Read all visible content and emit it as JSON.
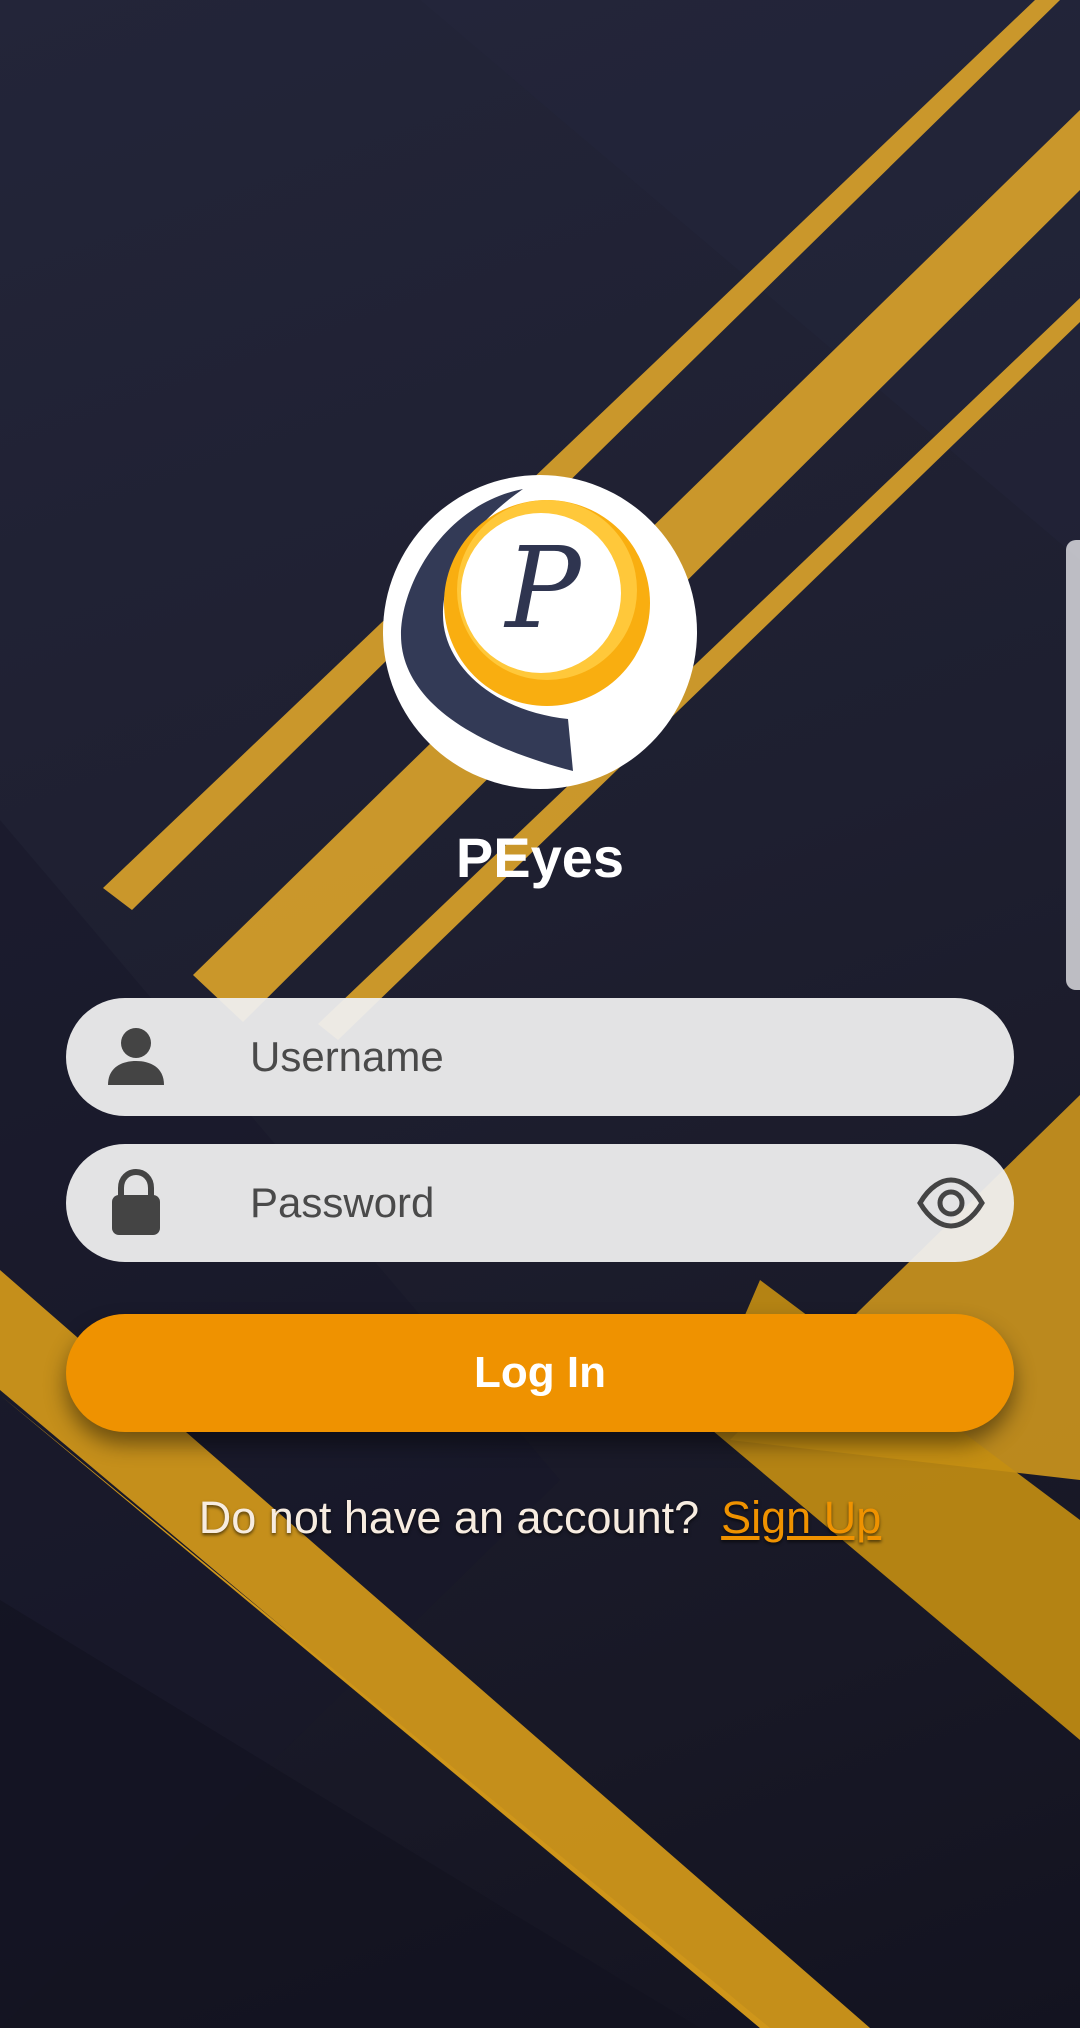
{
  "app": {
    "name": "PEyes",
    "logo_letter": "P"
  },
  "form": {
    "username_placeholder": "Username",
    "password_placeholder": "Password",
    "login_label": "Log In"
  },
  "signup": {
    "prompt": "Do not have an account?",
    "link_label": "Sign Up"
  },
  "icons": {
    "username": "person-icon",
    "password": "lock-icon",
    "toggle_visibility": "eye-icon"
  },
  "colors": {
    "background": "#1e1f30",
    "accent_stripes": "#d9a22a",
    "primary_button": "#ef9200",
    "link": "#ef9200",
    "field_background": "#eeeeee"
  }
}
